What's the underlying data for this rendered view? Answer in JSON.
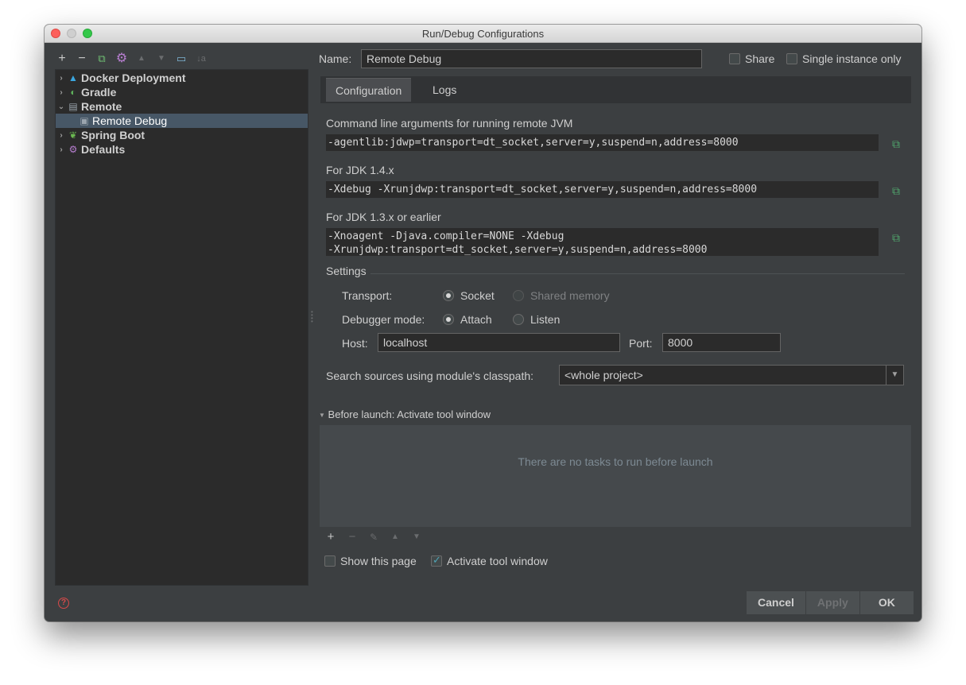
{
  "window": {
    "title": "Run/Debug Configurations"
  },
  "tree": {
    "items": [
      {
        "label": "Docker Deployment",
        "icon": "docker-icon",
        "arrow": "›"
      },
      {
        "label": "Gradle",
        "icon": "gradle-icon",
        "arrow": "›"
      },
      {
        "label": "Remote",
        "icon": "remote-icon",
        "arrow": "⌄"
      },
      {
        "label": "Remote Debug",
        "icon": "remote-debug-icon"
      },
      {
        "label": "Spring Boot",
        "icon": "spring-boot-icon",
        "arrow": "›"
      },
      {
        "label": "Defaults",
        "icon": "gear-icon",
        "arrow": "›"
      }
    ]
  },
  "toolbar": {
    "add": "+",
    "remove": "−",
    "copy": "⧉",
    "edit": "⚙",
    "up": "▲",
    "down": "▼",
    "folder": "▭",
    "sort": "↓a"
  },
  "header": {
    "name_label": "Name:",
    "name_value": "Remote Debug",
    "share_label": "Share",
    "single_instance_label": "Single instance only"
  },
  "tabs": [
    {
      "label": "Configuration"
    },
    {
      "label": "Logs"
    }
  ],
  "config": {
    "cmd_label": "Command line arguments for running remote JVM",
    "cmd_value": "-agentlib:jdwp=transport=dt_socket,server=y,suspend=n,address=8000",
    "jdk14_label": "For JDK 1.4.x",
    "jdk14_value": "-Xdebug -Xrunjdwp:transport=dt_socket,server=y,suspend=n,address=8000",
    "jdk13_label": "For JDK 1.3.x or earlier",
    "jdk13_value": "-Xnoagent -Djava.compiler=NONE -Xdebug\n-Xrunjdwp:transport=dt_socket,server=y,suspend=n,address=8000",
    "settings_label": "Settings",
    "transport_label": "Transport:",
    "transport_socket": "Socket",
    "transport_shared": "Shared memory",
    "debugger_label": "Debugger mode:",
    "debugger_attach": "Attach",
    "debugger_listen": "Listen",
    "host_label": "Host:",
    "host_value": "localhost",
    "port_label": "Port:",
    "port_value": "8000",
    "classpath_label": "Search sources using module's classpath:",
    "classpath_value": "<whole project>"
  },
  "before_launch": {
    "label": "Before launch: Activate tool window",
    "empty_text": "There are no tasks to run before launch",
    "show_page_label": "Show this page",
    "activate_label": "Activate tool window"
  },
  "buttons": {
    "cancel": "Cancel",
    "apply": "Apply",
    "ok": "OK",
    "help": "?"
  }
}
